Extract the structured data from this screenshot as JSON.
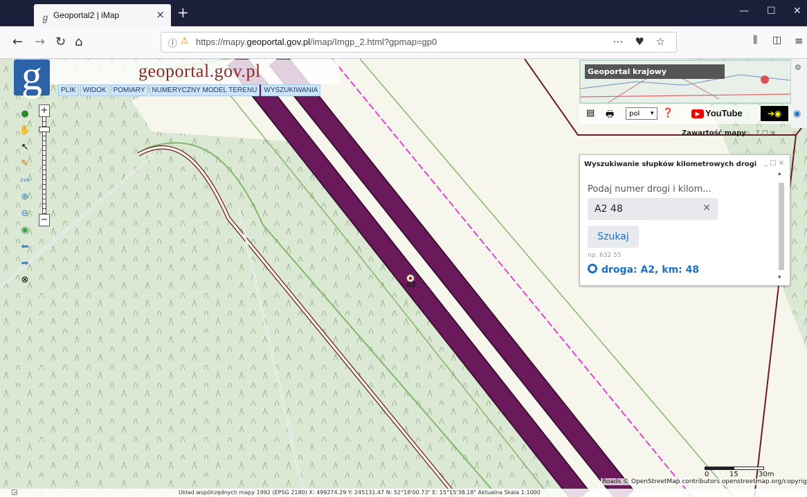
{
  "browser": {
    "tab_title": "Geoportal2 | iMap",
    "url_prefix": "https://mapy.",
    "url_domain": "geoportal.gov.pl",
    "url_suffix": "/imap/Imgp_2.html?gpmap=gp0"
  },
  "brand": {
    "logo_letter": "g",
    "title": "geoportal.gov.pl"
  },
  "menu": [
    "PLIK",
    "WIDOK",
    "POMIARY",
    "NUMERYCZNY MODEL TERENU",
    "WYSZUKIWANIA"
  ],
  "overview": {
    "label": "Geoportal krajowy"
  },
  "toolbar": {
    "language": "pol",
    "youtube_label": "YouTube"
  },
  "map_content": {
    "title": "Zawartość mapy",
    "controls": "? □ ×"
  },
  "search_panel": {
    "title": "Wyszukiwanie słupków kilometrowych drogi",
    "controls": "_ □ ×",
    "placeholder_label": "Podaj numer drogi i kilom...",
    "input_value": "A2 48",
    "clear": "×",
    "button": "Szukaj",
    "hint": "np. 632 55",
    "result": "droga: A2, km: 48"
  },
  "map": {
    "marker_label": "48",
    "zoom_in": "+",
    "zoom_out": "−"
  },
  "attribution": "Roads © OpenStreetMap contributors openstreetmap.org/copyright",
  "scale": {
    "start": "0",
    "mid": "15",
    "end": "30m"
  },
  "status": {
    "text": "Układ współrzędnych mapy 1992 (EPSG 2180)  X: 499274.29 Y: 245131.47  N: 52°18'00.73\" E: 15°15'38.18\"  Aktualna Skala 1:1000"
  },
  "colors": {
    "forest": "#dbe8d3",
    "road_band": "#f7f6ec",
    "motorway": "#6a1a5a",
    "accent": "#1a6fc7"
  }
}
